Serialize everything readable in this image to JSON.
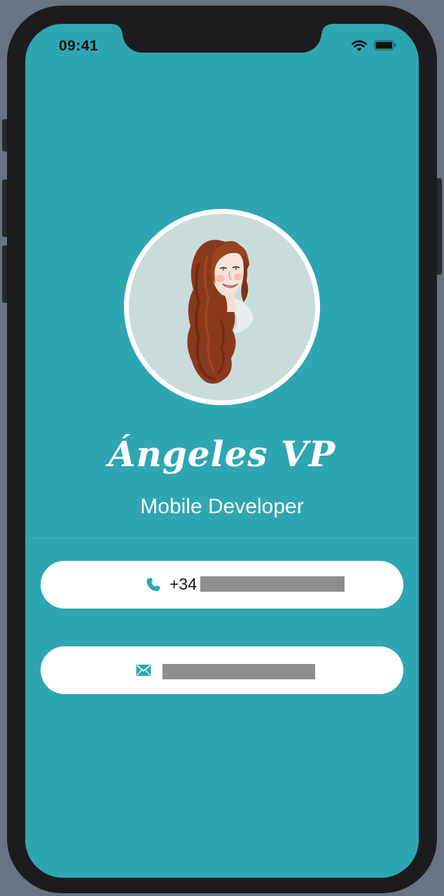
{
  "status_bar": {
    "time": "09:41",
    "wifi_icon": "wifi-icon",
    "battery_icon": "battery-icon"
  },
  "profile": {
    "name": "Ángeles VP",
    "title": "Mobile Developer",
    "avatar_icon": "illustrated-portrait"
  },
  "contacts": {
    "phone": {
      "icon": "phone-icon",
      "prefix": "+34"
    },
    "email": {
      "icon": "envelope-icon"
    }
  },
  "colors": {
    "background": "#2ea6b2",
    "card": "#ffffff",
    "icon": "#2ea6b2"
  }
}
